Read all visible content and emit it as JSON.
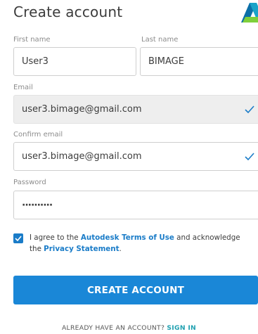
{
  "page": {
    "title": "Create account"
  },
  "form": {
    "first_name": {
      "label": "First name",
      "value": "User3"
    },
    "last_name": {
      "label": "Last name",
      "value": "BIMAGE"
    },
    "email": {
      "label": "Email",
      "value": "user3.bimage@gmail.com"
    },
    "confirm_email": {
      "label": "Confirm email",
      "value": "user3.bimage@gmail.com"
    },
    "password": {
      "label": "Password",
      "value": "··········"
    }
  },
  "agreement": {
    "checked": true,
    "text_before": "I agree to the ",
    "terms_link": "Autodesk Terms of Use",
    "text_middle": " and acknowledge the ",
    "privacy_link": "Privacy Statement",
    "text_after": "."
  },
  "actions": {
    "create_label": "CREATE ACCOUNT",
    "signin_prompt": "ALREADY HAVE AN ACCOUNT?",
    "signin_link": "SIGN IN"
  },
  "colors": {
    "accent": "#1a87d7",
    "link": "#1a7cc8",
    "signin": "#1fa0b0",
    "check": "#1a7cc8"
  },
  "icons": {
    "logo": "autodesk-logo-icon",
    "valid": "checkmark-icon"
  }
}
